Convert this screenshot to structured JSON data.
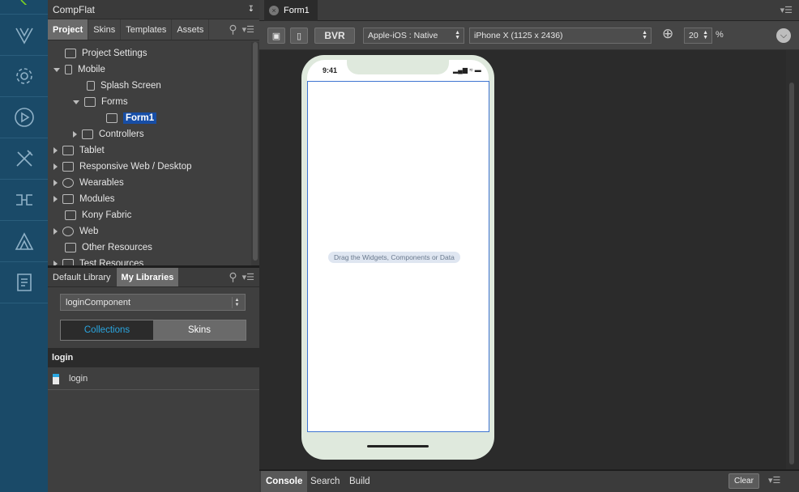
{
  "project_panel": {
    "title": "CompFlat",
    "tabs": [
      "Project",
      "Skins",
      "Templates",
      "Assets"
    ],
    "active_tab": "Project",
    "tree": [
      {
        "label": "Project Settings",
        "icon": "settings-sheet-icon"
      },
      {
        "label": "Mobile",
        "icon": "mobile-icon",
        "expanded": true
      },
      {
        "label": "Splash Screen",
        "icon": "splash-icon"
      },
      {
        "label": "Forms",
        "icon": "forms-icon",
        "expanded": true
      },
      {
        "label": "Form1",
        "icon": "form-icon",
        "selected": true
      },
      {
        "label": "Controllers",
        "icon": "folder-icon"
      },
      {
        "label": "Tablet",
        "icon": "tablet-icon"
      },
      {
        "label": "Responsive Web / Desktop",
        "icon": "desktop-icon"
      },
      {
        "label": "Wearables",
        "icon": "watch-icon"
      },
      {
        "label": "Modules",
        "icon": "folder-icon"
      },
      {
        "label": "Kony Fabric",
        "icon": "fabric-icon"
      },
      {
        "label": "Web",
        "icon": "globe-icon"
      },
      {
        "label": "Other Resources",
        "icon": "folder-icon"
      },
      {
        "label": "Test Resources",
        "icon": "folder-icon"
      }
    ]
  },
  "library_panel": {
    "tabs": [
      "Default Library",
      "My Libraries"
    ],
    "active_tab": "My Libraries",
    "library_select": "loginComponent",
    "segments": [
      "Collections",
      "Skins"
    ],
    "active_segment": "Collections",
    "section_header": "login",
    "items": [
      "login"
    ]
  },
  "editor": {
    "tab_label": "Form1",
    "bvr_label": "BVR",
    "platform_select": "Apple-iOS : Native",
    "device_select": "iPhone X (1125 x 2436)",
    "zoom_value": "20",
    "zoom_unit": "%",
    "phone_time": "9:41",
    "drop_hint": "Drag the Widgets, Components or Data"
  },
  "console": {
    "tabs": [
      "Console",
      "Search",
      "Build"
    ],
    "active_tab": "Console",
    "clear_label": "Clear"
  },
  "colors": {
    "rail": "#1a4a68",
    "selection": "#174ea6",
    "accent": "#2aa6e0"
  }
}
